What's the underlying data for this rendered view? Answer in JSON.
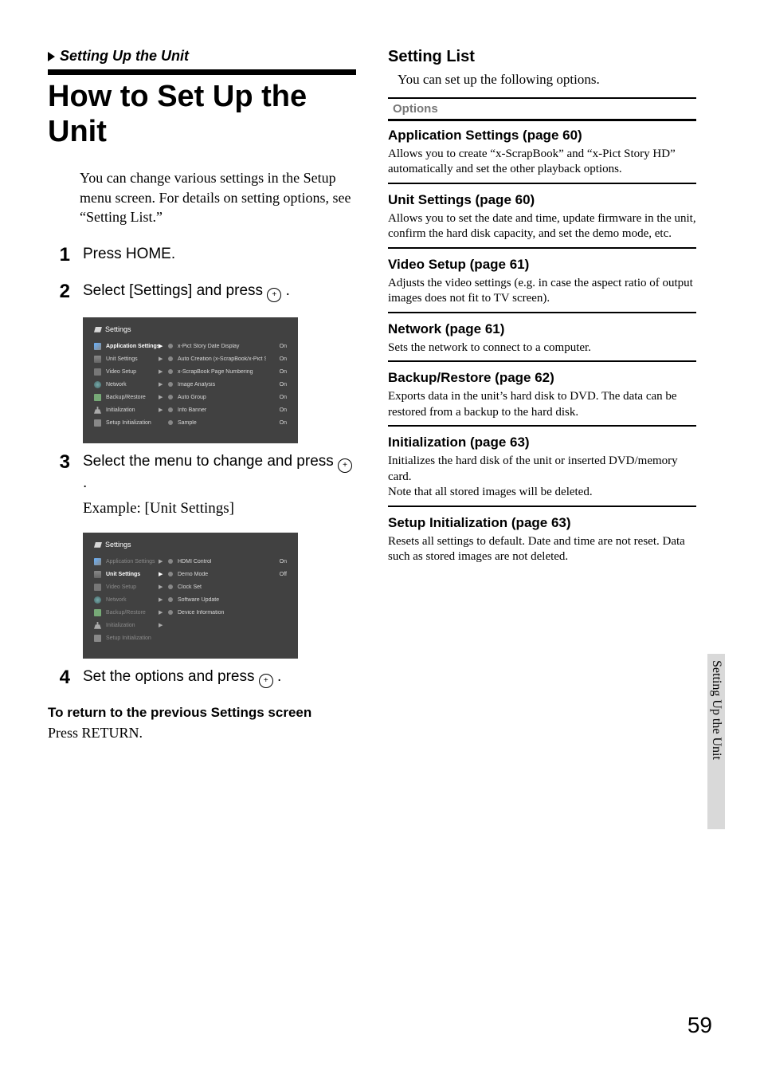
{
  "breadcrumb": "Setting Up the Unit",
  "title": "How to Set Up the Unit",
  "intro": "You can change various settings in the Setup menu screen. For details on setting options, see “Setting List.”",
  "steps": {
    "s1": {
      "num": "1",
      "text": "Press HOME."
    },
    "s2": {
      "num": "2",
      "text_a": "Select [Settings] and press ",
      "text_b": " ."
    },
    "s3": {
      "num": "3",
      "text_a": "Select the menu to change and press ",
      "text_b": " .",
      "example": "Example: [Unit Settings]"
    },
    "s4": {
      "num": "4",
      "text_a": "Set the options and press ",
      "text_b": " ."
    }
  },
  "return_heading": "To return to the previous Settings screen",
  "return_text": "Press RETURN.",
  "shot_title": "Settings",
  "shot1": {
    "menu": [
      "Application Settings",
      "Unit Settings",
      "Video Setup",
      "Network",
      "Backup/Restore",
      "Initialization",
      "Setup Initialization"
    ],
    "options": [
      {
        "label": "x-Pict Story Date Display",
        "val": "On"
      },
      {
        "label": "Auto Creation (x-ScrapBook/x-Pict Story)",
        "val": "On"
      },
      {
        "label": "x-ScrapBook Page Numbering",
        "val": "On"
      },
      {
        "label": "Image Analysis",
        "val": "On"
      },
      {
        "label": "Auto Group",
        "val": "On"
      },
      {
        "label": "Info Banner",
        "val": "On"
      },
      {
        "label": "Sample",
        "val": "On"
      }
    ]
  },
  "shot2": {
    "menu": [
      "Application Settings",
      "Unit Settings",
      "Video Setup",
      "Network",
      "Backup/Restore",
      "Initialization",
      "Setup Initialization"
    ],
    "options": [
      {
        "label": "HDMI Control",
        "val": "On"
      },
      {
        "label": "Demo Mode",
        "val": "Off"
      },
      {
        "label": "Clock Set",
        "val": ""
      },
      {
        "label": "Software Update",
        "val": ""
      },
      {
        "label": "Device Information",
        "val": ""
      }
    ]
  },
  "right": {
    "heading": "Setting List",
    "intro": "You can set up the following options.",
    "options_label": "Options",
    "items": [
      {
        "title": "Application Settings (page 60)",
        "desc": "Allows you to create “x-ScrapBook” and “x-Pict Story HD” automatically and set the other playback options."
      },
      {
        "title": "Unit Settings (page 60)",
        "desc": "Allows you to set the date and time, update firmware in the unit, confirm the hard disk capacity, and set the demo mode, etc."
      },
      {
        "title": "Video Setup (page 61)",
        "desc": "Adjusts the video settings (e.g. in case the aspect ratio of output images does not fit to TV screen)."
      },
      {
        "title": "Network (page 61)",
        "desc": "Sets the network to connect to a computer."
      },
      {
        "title": "Backup/Restore (page 62)",
        "desc": "Exports data in the unit’s hard disk to DVD. The data can be restored from a backup to the hard disk."
      },
      {
        "title": "Initialization (page 63)",
        "desc": "Initializes the hard disk of the unit or inserted DVD/memory card.\nNote that all stored images will be deleted."
      },
      {
        "title": "Setup Initialization (page 63)",
        "desc": "Resets all settings to default. Date and time are not reset. Data such as stored images are not deleted."
      }
    ]
  },
  "sidetab": "Setting Up the Unit",
  "page_number": "59"
}
